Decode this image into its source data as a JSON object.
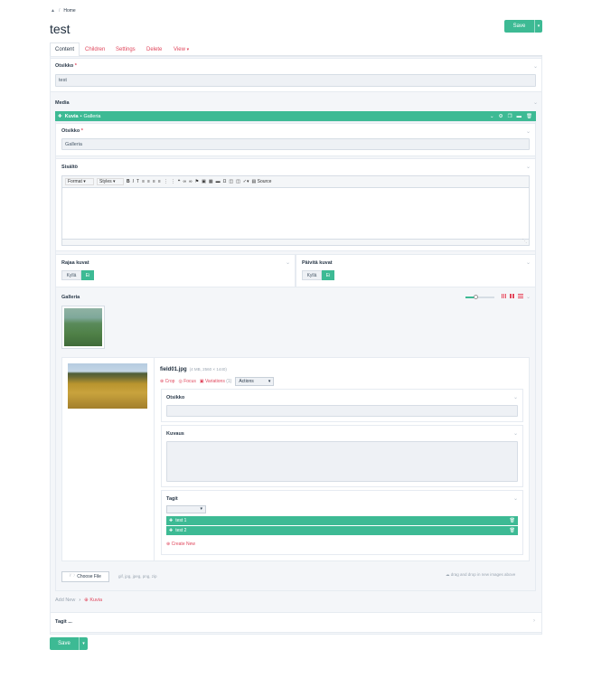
{
  "breadcrumb": {
    "home": "Home"
  },
  "page": {
    "title": "test"
  },
  "header": {
    "save_label": "Save"
  },
  "tabs": [
    {
      "label": "Content"
    },
    {
      "label": "Children"
    },
    {
      "label": "Settings"
    },
    {
      "label": "Delete"
    },
    {
      "label": "View"
    }
  ],
  "otsikko": {
    "label": "Otsikko",
    "value": "test"
  },
  "media": {
    "label": "Media",
    "block": {
      "type": "Kuvia",
      "sep": "•",
      "name": "Galleria",
      "otsikko_label": "Otsikko",
      "otsikko_value": "Galleria",
      "sisalto_label": "Sisältö",
      "toolbar": {
        "format": "Format",
        "styles": "Styles",
        "source": "Source"
      },
      "rajaa_label": "Rajaa kuvat",
      "paivita_label": "Päivitä kuvat",
      "yes": "Kyllä",
      "no": "Ei",
      "galleria_label": "Galleria",
      "file": {
        "name": "field01.jpg",
        "meta": "(4 MB, 2560 × 1440)",
        "crop": "Crop",
        "focus": "Focus",
        "variations": "Variations",
        "variations_count": "(1)",
        "actions": "Actions",
        "otsikko_label": "Otsikko",
        "kuvaus_label": "Kuvaus",
        "tagit_label": "Tagit",
        "tags": [
          "test 1",
          "test 2"
        ],
        "create_new": "Create New"
      },
      "choose_file": "Choose File",
      "file_types": "gif, jpg, jpeg, png, zip",
      "drag_drop": "drag and drop in new images above"
    },
    "add_new": "Add New",
    "add_new_item": "Kuvia"
  },
  "tagit_section": {
    "label": "Tagit ..."
  },
  "footer": {
    "save_label": "Save"
  },
  "colors": {
    "accent": "#3dba94",
    "link": "#e0465c",
    "panel_bg": "#f4f6f9"
  }
}
